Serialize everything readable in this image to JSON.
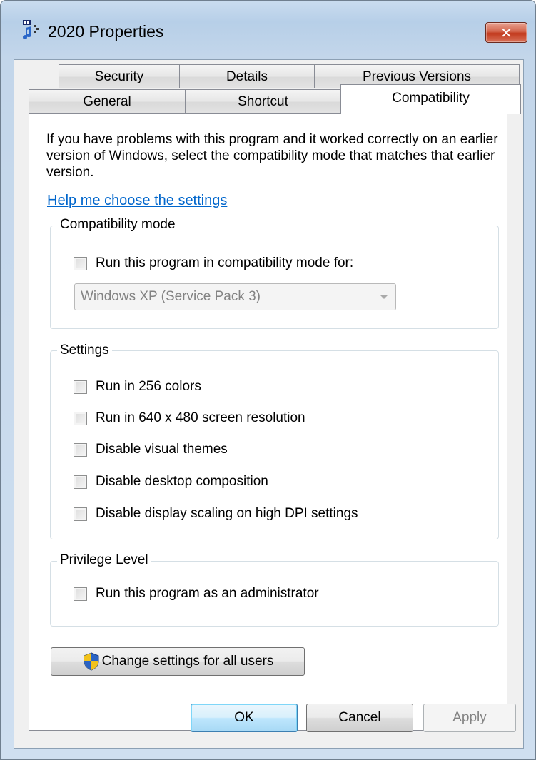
{
  "window": {
    "title": "2020 Properties",
    "close_glyph": "✕",
    "icon": "music-file-icon"
  },
  "tabs": {
    "row1": [
      {
        "label": "Security"
      },
      {
        "label": "Details"
      },
      {
        "label": "Previous Versions"
      }
    ],
    "row2": [
      {
        "label": "General"
      },
      {
        "label": "Shortcut"
      },
      {
        "label": "Compatibility",
        "active": true
      }
    ]
  },
  "compatibility": {
    "intro": "If you have problems with this program and it worked correctly on an earlier version of Windows, select the compatibility mode that matches that earlier version.",
    "help_link": "Help me choose the settings",
    "mode_group": {
      "label": "Compatibility mode",
      "checkbox": {
        "label": "Run this program in compatibility mode for:",
        "checked": false
      },
      "dropdown_value": "Windows XP (Service Pack 3)"
    },
    "settings_group": {
      "label": "Settings",
      "options": [
        {
          "label": "Run in 256 colors",
          "checked": false
        },
        {
          "label": "Run in 640 x 480 screen resolution",
          "checked": false
        },
        {
          "label": "Disable visual themes",
          "checked": false
        },
        {
          "label": "Disable desktop composition",
          "checked": false
        },
        {
          "label": "Disable display scaling on high DPI settings",
          "checked": false
        }
      ]
    },
    "privilege_group": {
      "label": "Privilege Level",
      "checkbox": {
        "label": "Run this program as an administrator",
        "checked": false
      }
    },
    "change_settings_button": "Change settings for all users"
  },
  "buttons": {
    "ok": "OK",
    "cancel": "Cancel",
    "apply": "Apply"
  },
  "colors": {
    "link": "#0066cc",
    "close_button": "#c2391d",
    "default_button": "#3c7fb1"
  }
}
